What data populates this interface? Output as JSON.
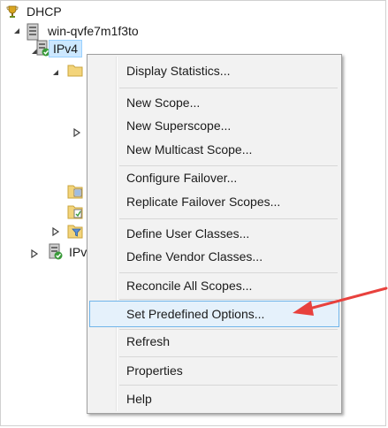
{
  "tree": {
    "root_label": "DHCP",
    "server_label": "win-qvfe7m1f3to",
    "ipv4_label": "IPv4",
    "ipv6_label_partial": "IPv"
  },
  "context_menu": {
    "items": [
      {
        "label": "Display Statistics..."
      },
      {
        "label": "New Scope..."
      },
      {
        "label": "New Superscope..."
      },
      {
        "label": "New Multicast Scope..."
      },
      {
        "label": "Configure Failover..."
      },
      {
        "label": "Replicate Failover Scopes..."
      },
      {
        "label": "Define User Classes..."
      },
      {
        "label": "Define Vendor Classes..."
      },
      {
        "label": "Reconcile All Scopes..."
      },
      {
        "label": "Set Predefined Options..."
      },
      {
        "label": "Refresh"
      },
      {
        "label": "Properties"
      },
      {
        "label": "Help"
      }
    ],
    "highlighted_item": "Set Predefined Options..."
  },
  "annotation": {
    "arrow_color": "#e8413d"
  }
}
